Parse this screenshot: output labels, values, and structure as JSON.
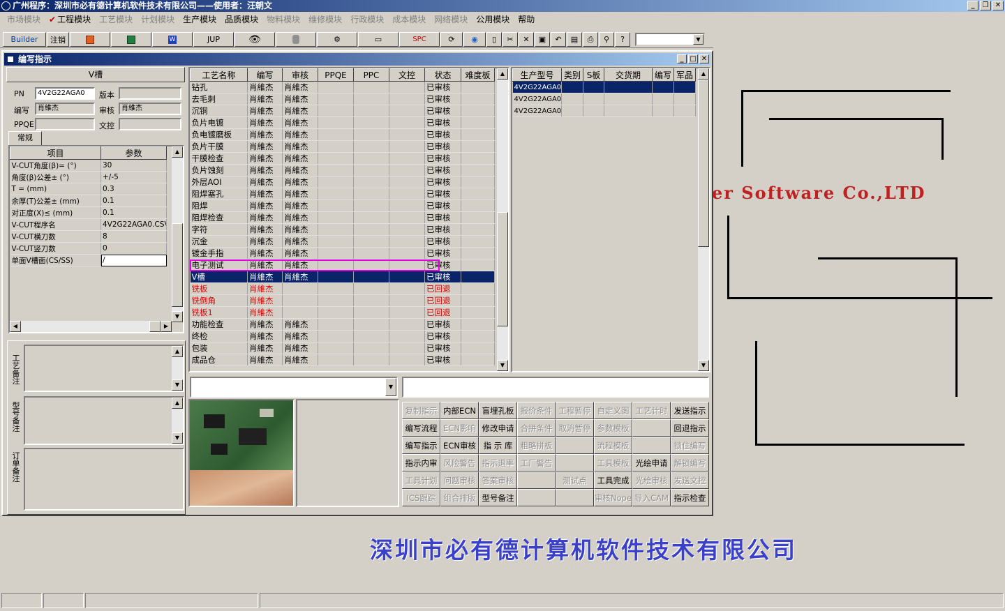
{
  "app_title": "广州程序：深圳市必有德计算机软件技术有限公司——使用者：汪朝文",
  "menu": [
    {
      "label": "市场模块",
      "disabled": true
    },
    {
      "label": "工程模块",
      "disabled": false,
      "checked": true
    },
    {
      "label": "工艺模块",
      "disabled": true
    },
    {
      "label": "计划模块",
      "disabled": true
    },
    {
      "label": "生产模块",
      "disabled": false
    },
    {
      "label": "品质模块",
      "disabled": false
    },
    {
      "label": "物料模块",
      "disabled": true
    },
    {
      "label": "维修模块",
      "disabled": true
    },
    {
      "label": "行政模块",
      "disabled": true
    },
    {
      "label": "成本模块",
      "disabled": true
    },
    {
      "label": "网络模块",
      "disabled": true
    },
    {
      "label": "公用模块",
      "disabled": false
    },
    {
      "label": "帮助",
      "disabled": false
    }
  ],
  "toolbar": {
    "builder": "Builder",
    "logout": "注销",
    "jup": "JUP",
    "spc": "SPC"
  },
  "child": {
    "title": "编写指示",
    "section_title": "V槽",
    "pn_label": "PN",
    "pn_value": "4V2G22AGA0",
    "version_label": "版本",
    "version_value": "",
    "author_label": "编写",
    "author_value": "肖維杰",
    "review_label": "审核",
    "review_value": "肖維杰",
    "ppqe_label": "PPQE",
    "ppqe_value": "",
    "wenkong_label": "文控",
    "wenkong_value": "",
    "tab_general": "常规",
    "param_headers": [
      "项目",
      "参数"
    ],
    "params": [
      [
        "V-CUT角度(β)=  (°)",
        "30"
      ],
      [
        "角度(β)公差±  (°)",
        "+/-5"
      ],
      [
        "T =  (mm)",
        "0.3"
      ],
      [
        "余厚(T)公差±  (mm)",
        "0.1"
      ],
      [
        "对正度(X)≤  (mm)",
        "0.1"
      ],
      [
        "V-CUT程序名",
        "4V2G22AGA0.CSV"
      ],
      [
        "V-CUT横刀数",
        "8"
      ],
      [
        "V-CUT竖刀数",
        "0"
      ],
      [
        "单面V槽面(CS/SS)",
        "/"
      ]
    ],
    "remark_labels": [
      "工艺备注",
      "型号备注",
      "订单备注"
    ],
    "process_headers": [
      "工艺名称",
      "编写",
      "审核",
      "PPQE",
      "PPC",
      "文控",
      "状态",
      "难度板"
    ],
    "processes": [
      {
        "name": "钻孔",
        "author": "肖維杰",
        "review": "肖維杰",
        "status": "已审核",
        "red": false
      },
      {
        "name": "去毛刺",
        "author": "肖維杰",
        "review": "肖維杰",
        "status": "已审核",
        "red": false
      },
      {
        "name": "沉铜",
        "author": "肖維杰",
        "review": "肖維杰",
        "status": "已审核",
        "red": false
      },
      {
        "name": "负片电镀",
        "author": "肖維杰",
        "review": "肖維杰",
        "status": "已审核",
        "red": false
      },
      {
        "name": "负电镀磨板",
        "author": "肖維杰",
        "review": "肖維杰",
        "status": "已审核",
        "red": false
      },
      {
        "name": "负片干膜",
        "author": "肖維杰",
        "review": "肖維杰",
        "status": "已审核",
        "red": false
      },
      {
        "name": "干膜检查",
        "author": "肖維杰",
        "review": "肖維杰",
        "status": "已审核",
        "red": false
      },
      {
        "name": "负片蚀刻",
        "author": "肖維杰",
        "review": "肖維杰",
        "status": "已审核",
        "red": false
      },
      {
        "name": "外层AOI",
        "author": "肖維杰",
        "review": "肖維杰",
        "status": "已审核",
        "red": false
      },
      {
        "name": "阻焊塞孔",
        "author": "肖維杰",
        "review": "肖維杰",
        "status": "已审核",
        "red": false
      },
      {
        "name": "阻焊",
        "author": "肖維杰",
        "review": "肖維杰",
        "status": "已审核",
        "red": false
      },
      {
        "name": "阻焊检查",
        "author": "肖維杰",
        "review": "肖維杰",
        "status": "已审核",
        "red": false
      },
      {
        "name": "字符",
        "author": "肖維杰",
        "review": "肖維杰",
        "status": "已审核",
        "red": false
      },
      {
        "name": "沉金",
        "author": "肖維杰",
        "review": "肖維杰",
        "status": "已审核",
        "red": false
      },
      {
        "name": "镀金手指",
        "author": "肖維杰",
        "review": "肖維杰",
        "status": "已审核",
        "red": false
      },
      {
        "name": "电子测试",
        "author": "肖維杰",
        "review": "肖維杰",
        "status": "已审核",
        "red": false,
        "outlined": true
      },
      {
        "name": "V槽",
        "author": "肖維杰",
        "review": "肖維杰",
        "status": "已审核",
        "red": false,
        "selected": true
      },
      {
        "name": "铣板",
        "author": "肖維杰",
        "review": "",
        "status": "已回退",
        "red": true
      },
      {
        "name": "铣倒角",
        "author": "肖維杰",
        "review": "",
        "status": "已回退",
        "red": true
      },
      {
        "name": "铣板1",
        "author": "肖維杰",
        "review": "",
        "status": "已回退",
        "red": true
      },
      {
        "name": "功能检查",
        "author": "肖維杰",
        "review": "肖維杰",
        "status": "已审核",
        "red": false
      },
      {
        "name": "终检",
        "author": "肖維杰",
        "review": "肖維杰",
        "status": "已审核",
        "red": false
      },
      {
        "name": "包装",
        "author": "肖維杰",
        "review": "肖維杰",
        "status": "已审核",
        "red": false
      },
      {
        "name": "成品仓",
        "author": "肖維杰",
        "review": "肖維杰",
        "status": "已审核",
        "red": false
      }
    ],
    "model_headers": [
      "生产型号",
      "类别",
      "S板",
      "交货期",
      "编写",
      "军品"
    ],
    "models": [
      {
        "model": "4V2G22AGA0",
        "selected": true
      },
      {
        "model": "4V2G22AGA0",
        "selected": false
      },
      {
        "model": "4V2G22AGA0",
        "selected": false
      }
    ],
    "buttons": [
      {
        "label": "复制指示",
        "dis": true
      },
      {
        "label": "内部ECN",
        "dis": false
      },
      {
        "label": "盲埋孔板",
        "dis": false
      },
      {
        "label": "报价条件",
        "dis": true
      },
      {
        "label": "工程暂停",
        "dis": true
      },
      {
        "label": "自定义图",
        "dis": true
      },
      {
        "label": "工艺计时",
        "dis": true
      },
      {
        "label": "发送指示",
        "dis": false
      },
      {
        "label": "编写流程",
        "dis": false
      },
      {
        "label": "ECN影响",
        "dis": true
      },
      {
        "label": "修改申请",
        "dis": false
      },
      {
        "label": "合拼条件",
        "dis": true
      },
      {
        "label": "取消暂停",
        "dis": true
      },
      {
        "label": "参数模板",
        "dis": true
      },
      {
        "label": "",
        "dis": true
      },
      {
        "label": "回退指示",
        "dis": false
      },
      {
        "label": "编写指示",
        "dis": false
      },
      {
        "label": "ECN审核",
        "dis": false
      },
      {
        "label": "指 示 库",
        "dis": false
      },
      {
        "label": "粗略拼板",
        "dis": true
      },
      {
        "label": "",
        "dis": true
      },
      {
        "label": "流程模板",
        "dis": true
      },
      {
        "label": "",
        "dis": true
      },
      {
        "label": "锁住编写",
        "dis": true
      },
      {
        "label": "指示内审",
        "dis": false
      },
      {
        "label": "风险警告",
        "dis": true
      },
      {
        "label": "指示退率",
        "dis": true
      },
      {
        "label": "工厂警告",
        "dis": true
      },
      {
        "label": "",
        "dis": true
      },
      {
        "label": "工具模板",
        "dis": true
      },
      {
        "label": "光绘申请",
        "dis": false
      },
      {
        "label": "解锁编写",
        "dis": true
      },
      {
        "label": "工具计划",
        "dis": true
      },
      {
        "label": "问题审核",
        "dis": true
      },
      {
        "label": "答案审核",
        "dis": true
      },
      {
        "label": "",
        "dis": true
      },
      {
        "label": "测试点",
        "dis": true
      },
      {
        "label": "工具完成",
        "dis": false
      },
      {
        "label": "光绘审核",
        "dis": true
      },
      {
        "label": "发送文控",
        "dis": true
      },
      {
        "label": "ICS跟踪",
        "dis": true
      },
      {
        "label": "组合排版",
        "dis": true
      },
      {
        "label": "型号备注",
        "dis": false
      },
      {
        "label": "",
        "dis": true
      },
      {
        "label": "",
        "dis": true
      },
      {
        "label": "审核Nope",
        "dis": true
      },
      {
        "label": "导入CAM",
        "dis": true
      },
      {
        "label": "指示检查",
        "dis": false
      }
    ]
  },
  "brand_en": "er Software Co.,LTD",
  "brand_cn": "深圳市必有德计算机软件技术有限公司",
  "colors": {
    "selection": "#0a246a",
    "red_text": "#e00000",
    "highlight_outline": "#e000e0"
  }
}
